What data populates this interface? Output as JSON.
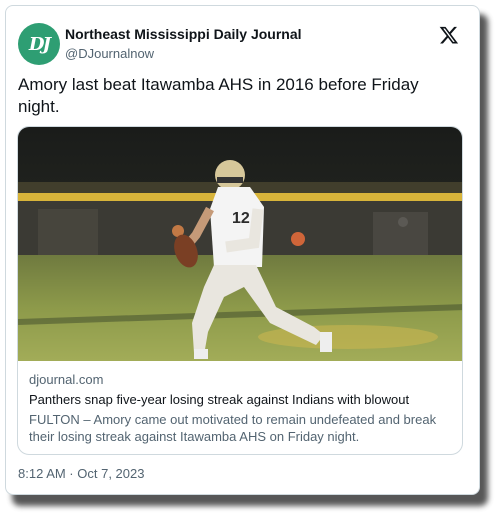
{
  "account": {
    "display_name": "Northeast Mississippi Daily Journal",
    "handle": "@DJournalnow",
    "avatar_icon": "dj-logo-icon",
    "avatar_color": "#2e9e73"
  },
  "tweet": {
    "text": "Amory last beat Itawamba AHS in 2016 before Friday night.",
    "timestamp": "8:12 AM · Oct 7, 2023"
  },
  "link_card": {
    "domain": "djournal.com",
    "headline": "Panthers snap five-year losing streak against Indians with blowout",
    "description": "FULTON – Amory came out motivated to remain undefeated and break their losing streak against Itawamba AHS on Friday night.",
    "image_subject": "football quarterback jersey 12",
    "jersey_number": "12"
  },
  "brand": {
    "platform_icon": "x-logo-icon"
  }
}
